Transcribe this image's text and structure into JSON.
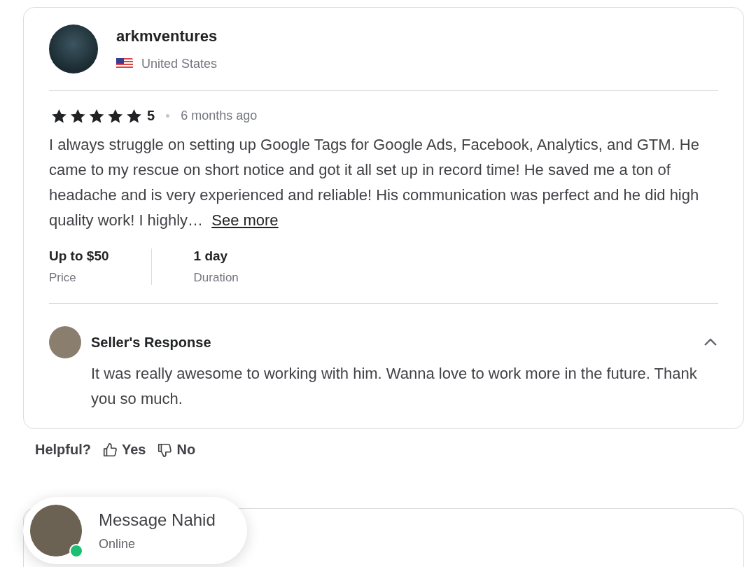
{
  "review": {
    "reviewer": {
      "name": "arkmventures",
      "country": "United States"
    },
    "stars": 5,
    "rating": "5",
    "time": "6 months ago",
    "text": "I always struggle on setting up Google Tags for Google Ads, Facebook, Analytics, and GTM. He came to my rescue on short notice and got it all set up in record time! He saved me a ton of headache and is very experienced and reliable! His communication was perfect and he did high quality work! I highly…",
    "see_more": "See more",
    "details": [
      {
        "value": "Up to $50",
        "label": "Price"
      },
      {
        "value": "1 day",
        "label": "Duration"
      }
    ],
    "seller_response": {
      "title": "Seller's Response",
      "expanded": true,
      "text": "It was really awesome to working with him. Wanna love to work more in the future. Thank you so much."
    }
  },
  "helpful": {
    "label": "Helpful?",
    "yes": "Yes",
    "no": "No"
  },
  "chat": {
    "title": "Message Nahid",
    "status": "Online",
    "online": true
  }
}
